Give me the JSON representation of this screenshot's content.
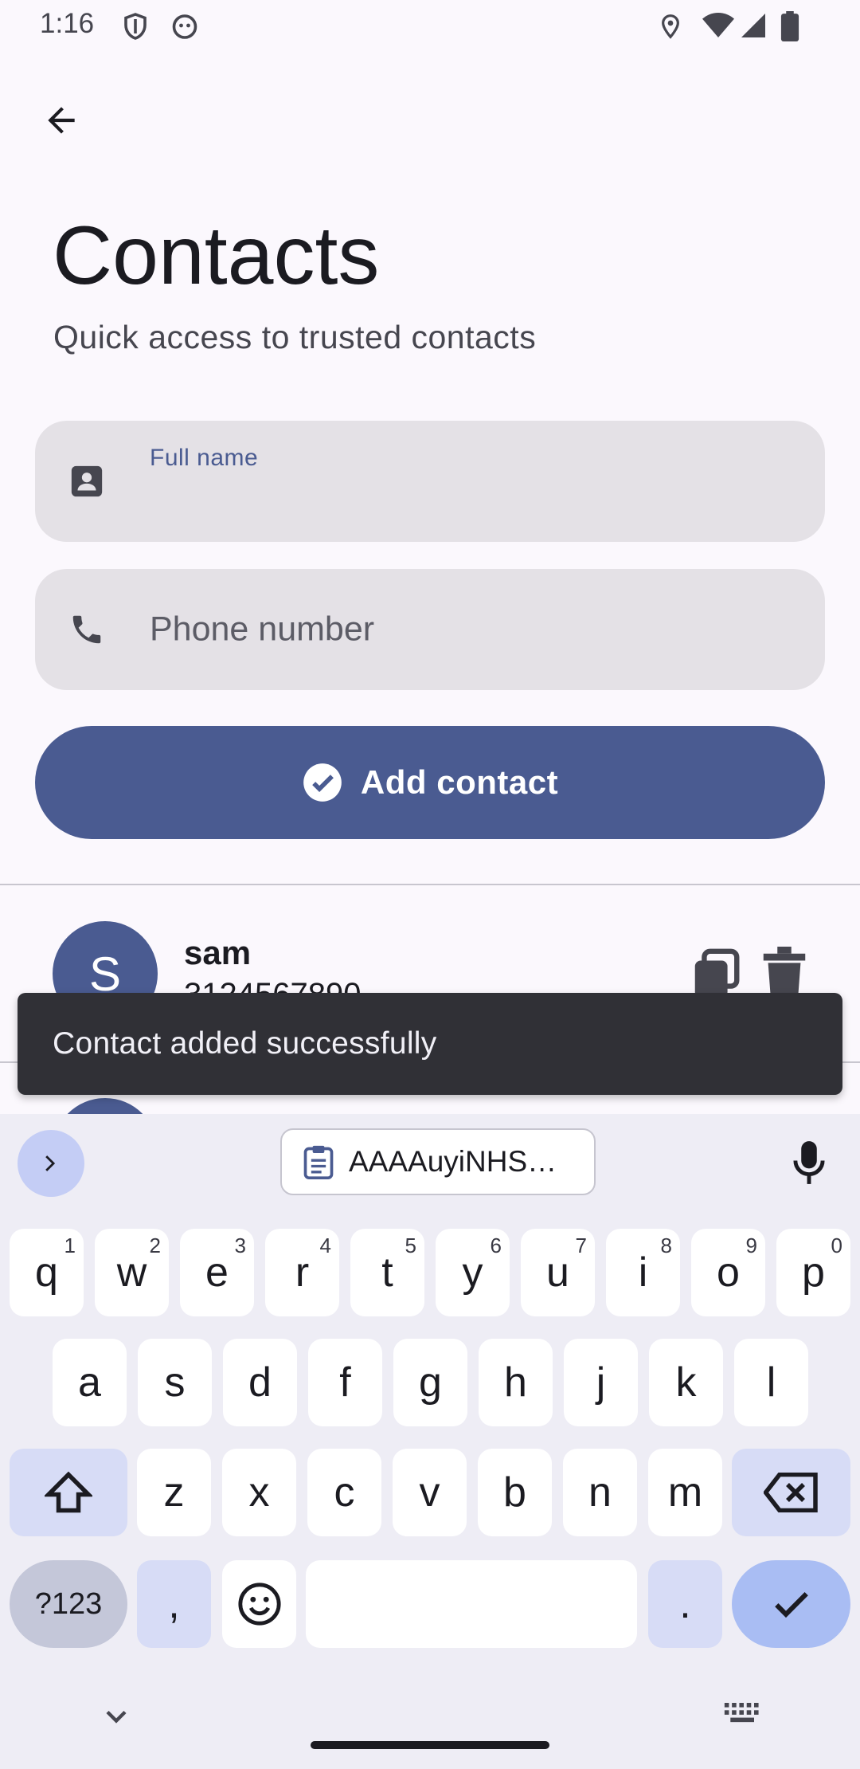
{
  "status_bar": {
    "time": "1:16"
  },
  "header": {
    "title": "Contacts",
    "subtitle": "Quick access to trusted contacts"
  },
  "form": {
    "name_label": "Full name",
    "name_value": "",
    "phone_placeholder": "Phone number",
    "phone_value": "",
    "add_button_label": "Add contact"
  },
  "contacts": [
    {
      "initial": "S",
      "name": "sam",
      "phone": "3124567890"
    }
  ],
  "snackbar": {
    "message": "Contact added successfully"
  },
  "keyboard": {
    "clipboard_text": "AAAAuyiNHS…",
    "row1": [
      {
        "key": "q",
        "hint": "1"
      },
      {
        "key": "w",
        "hint": "2"
      },
      {
        "key": "e",
        "hint": "3"
      },
      {
        "key": "r",
        "hint": "4"
      },
      {
        "key": "t",
        "hint": "5"
      },
      {
        "key": "y",
        "hint": "6"
      },
      {
        "key": "u",
        "hint": "7"
      },
      {
        "key": "i",
        "hint": "8"
      },
      {
        "key": "o",
        "hint": "9"
      },
      {
        "key": "p",
        "hint": "0"
      }
    ],
    "row2": [
      "a",
      "s",
      "d",
      "f",
      "g",
      "h",
      "j",
      "k",
      "l"
    ],
    "row3": [
      "z",
      "x",
      "c",
      "v",
      "b",
      "n",
      "m"
    ],
    "mode_label": "?123",
    "comma": ",",
    "period": "."
  },
  "colors": {
    "primary": "#4a5b91",
    "background": "#fbf8fd",
    "field": "#e4e1e6",
    "snackbar": "#303036"
  }
}
